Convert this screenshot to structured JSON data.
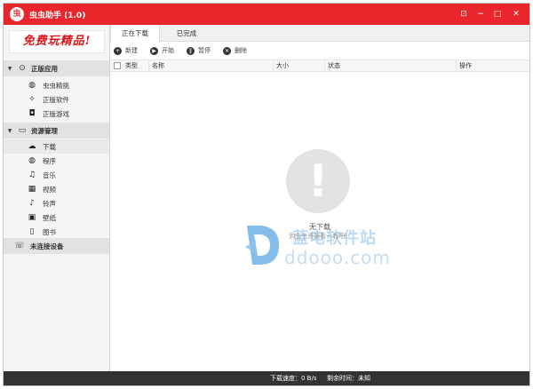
{
  "window": {
    "logo_text": "虫",
    "title": "虫虫助手 (1.0)",
    "controls": {
      "menu": "⊡",
      "minimize": "−",
      "maximize": "□",
      "close": "✕"
    }
  },
  "sidebar": {
    "slogan": "免费玩精品!",
    "groups": [
      {
        "label": "正版应用",
        "arrow": "▼",
        "icon": "⊙",
        "items": [
          {
            "label": "虫虫精挑",
            "icon": "◍"
          },
          {
            "label": "正版软件",
            "icon": "✧"
          },
          {
            "label": "正版游戏",
            "icon": "◘"
          }
        ]
      },
      {
        "label": "资源管理",
        "arrow": "▼",
        "icon": "▭",
        "items": [
          {
            "label": "下载",
            "icon": "☁"
          },
          {
            "label": "程序",
            "icon": "◍"
          },
          {
            "label": "音乐",
            "icon": "♫"
          },
          {
            "label": "视频",
            "icon": "▦"
          },
          {
            "label": "铃声",
            "icon": "♪"
          },
          {
            "label": "壁纸",
            "icon": "▣"
          },
          {
            "label": "图书",
            "icon": "▯"
          }
        ]
      }
    ],
    "devices": {
      "label": "未连接设备",
      "icon": "☏"
    }
  },
  "tabs": [
    {
      "label": "正在下载",
      "active": true
    },
    {
      "label": "已完成",
      "active": false
    }
  ],
  "toolbar": [
    {
      "label": "新建",
      "icon": "+"
    },
    {
      "label": "开始",
      "icon": "▶"
    },
    {
      "label": "暂停",
      "icon": "‖"
    },
    {
      "label": "删除",
      "icon": "✕"
    }
  ],
  "table": {
    "columns": [
      "类型",
      "名称",
      "大小",
      "状态",
      "操作"
    ]
  },
  "empty_state": {
    "icon": "!",
    "title": "无下载",
    "hint": "到虫虫资源看一看吧！"
  },
  "watermark": {
    "chinese": "蓝电软件站",
    "url": "ddooo.com",
    "colors": {
      "primary": "#1f86d8",
      "light": "#8fc3ea"
    }
  },
  "status": {
    "speed": "下载速度：0 B/s",
    "remaining": "剩余时间：未知"
  },
  "colors": {
    "title_bar": "#e8262b",
    "status_bar": "#333333"
  }
}
